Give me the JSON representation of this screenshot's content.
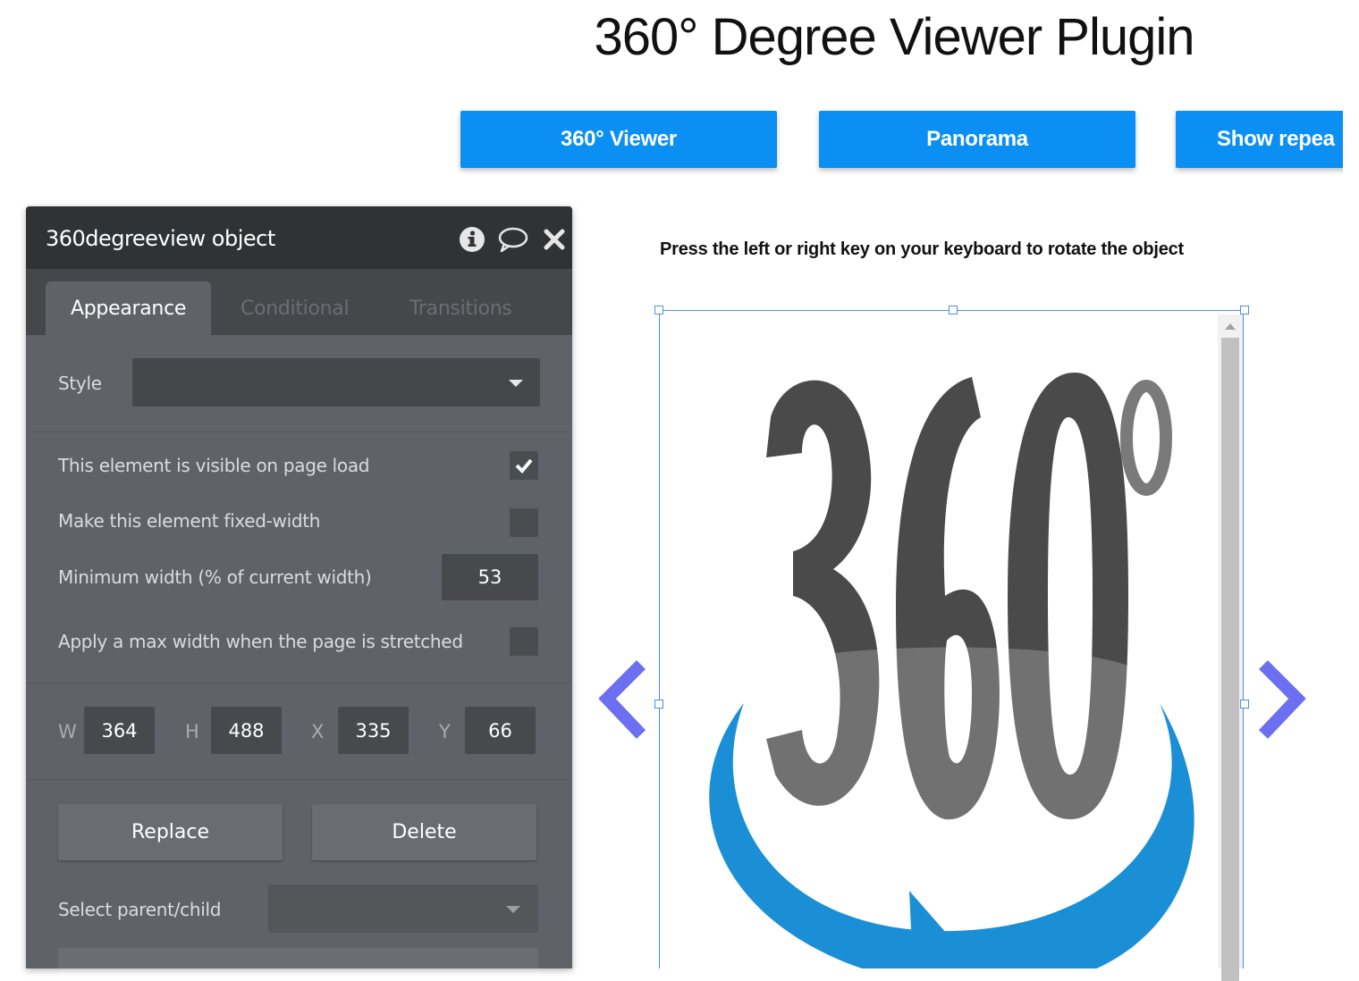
{
  "page": {
    "title": "360° Degree Viewer Plugin"
  },
  "nav": {
    "buttons": [
      {
        "label": "360° Viewer"
      },
      {
        "label": "Panorama"
      },
      {
        "label": "Show repea"
      }
    ],
    "accent_color": "#0b8ff2"
  },
  "panel": {
    "title": "360degreeview object",
    "header_icons": [
      "info-icon",
      "comment-icon",
      "close-icon"
    ],
    "tabs": [
      {
        "label": "Appearance",
        "active": true
      },
      {
        "label": "Conditional",
        "active": false
      },
      {
        "label": "Transitions",
        "active": false
      }
    ],
    "style": {
      "label": "Style",
      "value": ""
    },
    "options": {
      "visible_on_load": {
        "label": "This element is visible on page load",
        "checked": true
      },
      "fixed_width": {
        "label": "Make this element fixed-width",
        "checked": false
      },
      "min_width": {
        "label": "Minimum width (% of current width)",
        "value": "53"
      },
      "max_width": {
        "label": "Apply a max width when the page is stretched",
        "checked": false
      }
    },
    "geometry": {
      "w_label": "W",
      "w": "364",
      "h_label": "H",
      "h": "488",
      "x_label": "X",
      "x": "335",
      "y_label": "Y",
      "y": "66"
    },
    "actions": {
      "replace": "Replace",
      "delete": "Delete"
    },
    "parent_child": {
      "label": "Select parent/child",
      "value": ""
    }
  },
  "canvas": {
    "hint": "Press the left or right key on your keyboard to rotate the object",
    "viewer_image": "360-logo-image",
    "prev_icon": "chevron-left-icon",
    "next_icon": "chevron-right-icon",
    "arrow_color": "#6b6ff0"
  }
}
